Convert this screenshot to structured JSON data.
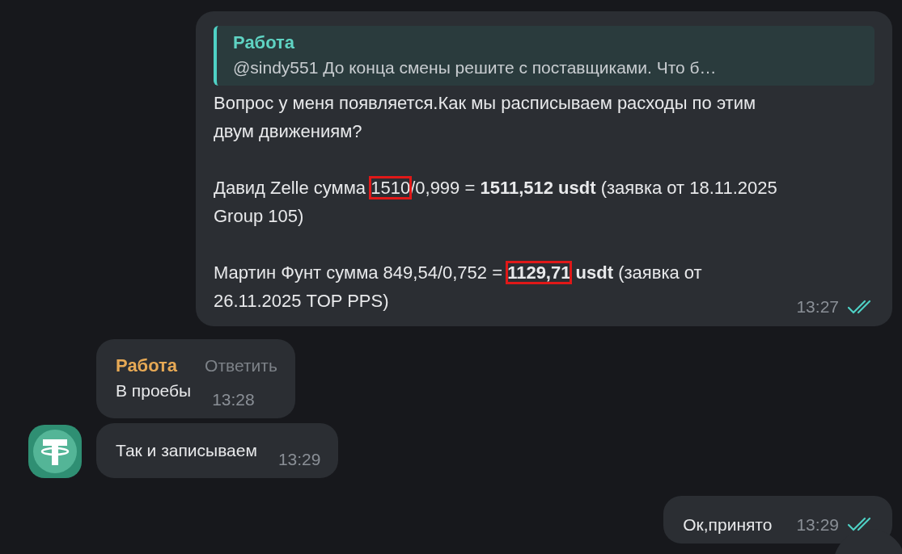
{
  "messages": [
    {
      "kind": "outgoing",
      "reply": {
        "author": "Работа",
        "text": "@sindy551  До конца смены решите с поставщиками. Что б…"
      },
      "paragraphs": [
        [
          {
            "text": "Вопрос у меня появляется.Как мы расписываем расходы по этим двум движениям?",
            "bold": false,
            "highlighted": false
          }
        ],
        [
          {
            "text": "Давид Zelle сумма ",
            "bold": false,
            "highlighted": false
          },
          {
            "text": "1510",
            "bold": false,
            "highlighted": true
          },
          {
            "text": "/0,999 = ",
            "bold": false,
            "highlighted": false
          },
          {
            "text": "1511,512 usdt",
            "bold": true,
            "highlighted": false
          },
          {
            "text": " (заявка от 18.11.2025 Group 105)",
            "bold": false,
            "highlighted": false
          }
        ],
        [
          {
            "text": "Мартин Фунт сумма 849,54/0,752 = ",
            "bold": false,
            "highlighted": false
          },
          {
            "text": "1129,71",
            "bold": true,
            "highlighted": true
          },
          {
            "text": " usdt",
            "bold": true,
            "highlighted": false
          },
          {
            "text": " (заявка от 26.11.2025 TOP PPS)",
            "bold": false,
            "highlighted": false
          }
        ]
      ],
      "time": "13:27",
      "read": true
    },
    {
      "kind": "incoming",
      "author": "Работа",
      "action": "Ответить",
      "text": "В проебы",
      "time": "13:28",
      "avatar": false
    },
    {
      "kind": "incoming",
      "text": "Так и записываем",
      "time": "13:29",
      "avatar": true
    },
    {
      "kind": "outgoing",
      "text": "Ок,принято",
      "time": "13:29",
      "read": true
    }
  ]
}
